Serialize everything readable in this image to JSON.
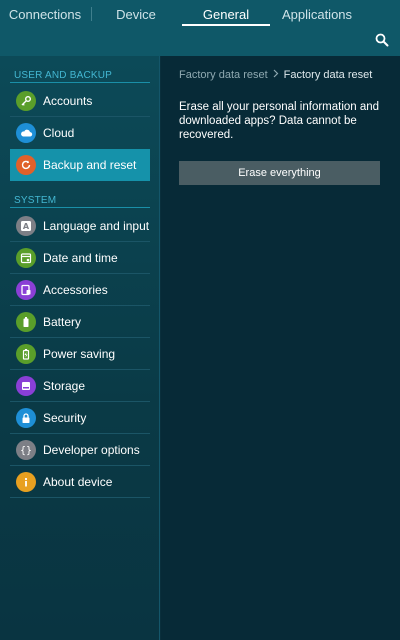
{
  "tabs": [
    {
      "label": "Connections"
    },
    {
      "label": "Device"
    },
    {
      "label": "General",
      "active": true
    },
    {
      "label": "Applications"
    }
  ],
  "colors": {
    "accent": "#1592aa",
    "section_header": "#43b7d2",
    "tab_bar": "#0f5868",
    "content_bg": "#072a37"
  },
  "sidebar": {
    "sections": [
      {
        "header": "USER AND BACKUP",
        "items": [
          {
            "label": "Accounts",
            "icon": "key-icon",
            "icon_color": "#5a9e2a"
          },
          {
            "label": "Cloud",
            "icon": "cloud-icon",
            "icon_color": "#1e8fd6"
          },
          {
            "label": "Backup and reset",
            "icon": "reset-icon",
            "icon_color": "#e0612a",
            "selected": true
          }
        ]
      },
      {
        "header": "SYSTEM",
        "items": [
          {
            "label": "Language and input",
            "icon": "keyboard-icon",
            "icon_color": "#7d7f86"
          },
          {
            "label": "Date and time",
            "icon": "calendar-icon",
            "icon_color": "#5a9e2a"
          },
          {
            "label": "Accessories",
            "icon": "accessories-icon",
            "icon_color": "#8a3fd6"
          },
          {
            "label": "Battery",
            "icon": "battery-icon",
            "icon_color": "#5a9e2a"
          },
          {
            "label": "Power saving",
            "icon": "power-saving-icon",
            "icon_color": "#5a9e2a"
          },
          {
            "label": "Storage",
            "icon": "storage-icon",
            "icon_color": "#8a3fd6"
          },
          {
            "label": "Security",
            "icon": "lock-icon",
            "icon_color": "#1e8fd6"
          },
          {
            "label": "Developer options",
            "icon": "braces-icon",
            "icon_color": "#7d7f86"
          },
          {
            "label": "About device",
            "icon": "info-icon",
            "icon_color": "#e8a020"
          }
        ]
      }
    ]
  },
  "detail": {
    "breadcrumb_parent": "Factory data reset",
    "breadcrumb_current": "Factory data reset",
    "description": "Erase all your personal information and downloaded apps? Data cannot be recovered.",
    "erase_button_label": "Erase everything"
  }
}
